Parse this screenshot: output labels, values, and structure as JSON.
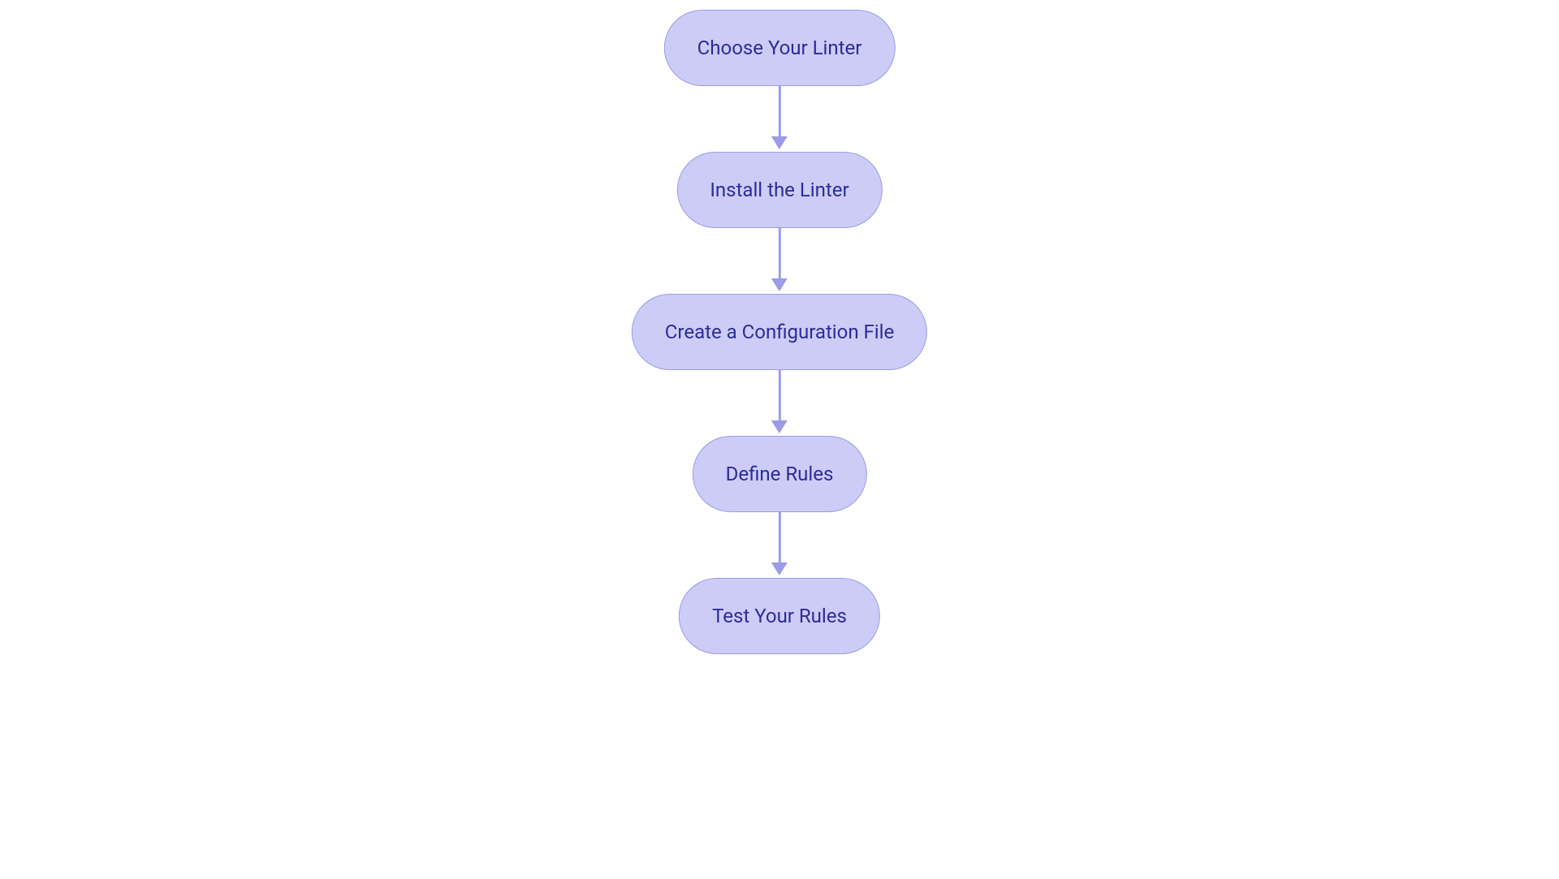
{
  "flowchart": {
    "nodes": [
      {
        "label": "Choose Your Linter"
      },
      {
        "label": "Install the Linter"
      },
      {
        "label": "Create a Configuration File"
      },
      {
        "label": "Define Rules"
      },
      {
        "label": "Test Your Rules"
      }
    ]
  },
  "colors": {
    "node_fill": "#ccccf7",
    "node_border": "#9b9be8",
    "text": "#2c2c99",
    "arrow": "#9b9be8"
  }
}
